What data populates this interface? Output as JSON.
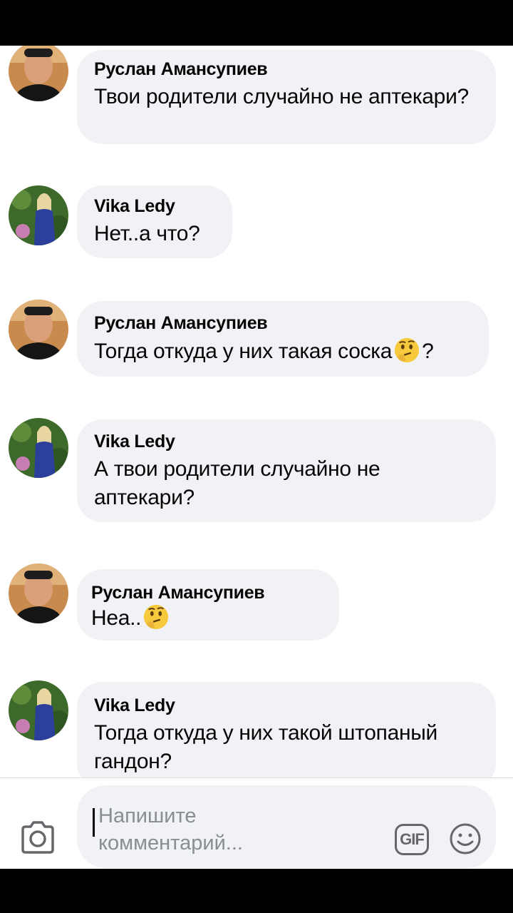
{
  "comments": [
    {
      "author": "Руслан Амансупиев",
      "text": "Твои родители случайно не аптекари?",
      "emoji": ""
    },
    {
      "author": "Vika Ledy",
      "text": "Нет..а что?",
      "emoji": ""
    },
    {
      "author": "Руслан Амансупиев",
      "text": "Тогда откуда у них такая соска",
      "emoji": "thinking-face",
      "suffix": "?"
    },
    {
      "author": "Vika Ledy",
      "text": "А твои родители случайно не аптекари?",
      "emoji": ""
    },
    {
      "author": "Руслан Амансупиев",
      "text": "Неа..",
      "emoji": "thinking-face",
      "suffix": ""
    },
    {
      "author": "Vika Ledy",
      "text": "Тогда откуда у них такой штопаный гандон?",
      "emoji": ""
    }
  ],
  "composer": {
    "placeholder": "Напишите комментарий...",
    "gif_label": "GIF",
    "icons": [
      "camera-icon",
      "gif-icon",
      "smiley-icon"
    ]
  },
  "colors": {
    "bubble": "#f0f2f5",
    "text": "#050505",
    "muted": "#8a8d91",
    "icon": "#65676b"
  }
}
